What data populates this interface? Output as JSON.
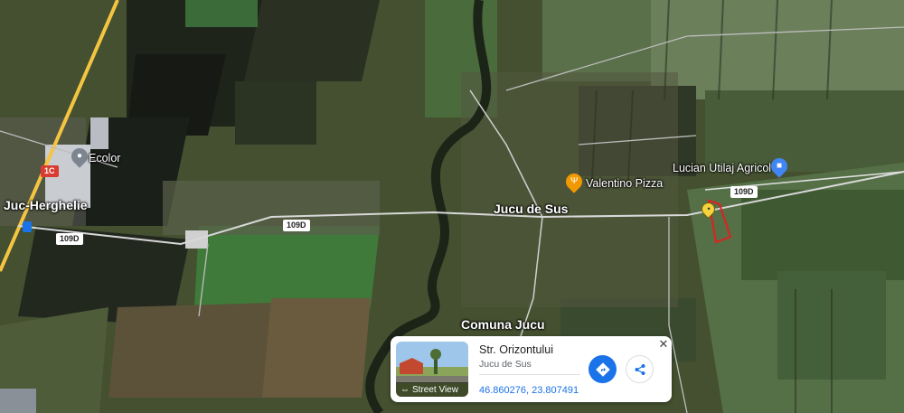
{
  "map": {
    "places": {
      "ecolor": "Ecolor",
      "juc_herghelie": "Juc-Herghelie",
      "valentino_pizza": "Valentino Pizza",
      "lucian_utilaj": "Lucian Utilaj Agricol",
      "jucu_de_sus": "Jucu de Sus",
      "comuna_jucu": "Comuna Jucu"
    },
    "roads": {
      "r1c": "1C",
      "r109d_a": "109D",
      "r109d_b": "109D",
      "r109d_c": "109D"
    },
    "colors": {
      "road_yellow": "#f5c542",
      "plot_outline": "#e02020",
      "accent_blue": "#1a73e8",
      "pizza_orange": "#f29900",
      "pin_yellow": "#f6d33c"
    }
  },
  "info_card": {
    "title": "Str. Orizontului",
    "subtitle": "Jucu de Sus",
    "coordinates": "46.860276, 23.807491",
    "street_view_label": "Street View",
    "close_symbol": "✕"
  },
  "icons": {
    "directions": "directions-icon",
    "share": "share-icon",
    "street_view": "street-view-icon",
    "close": "close-icon"
  }
}
